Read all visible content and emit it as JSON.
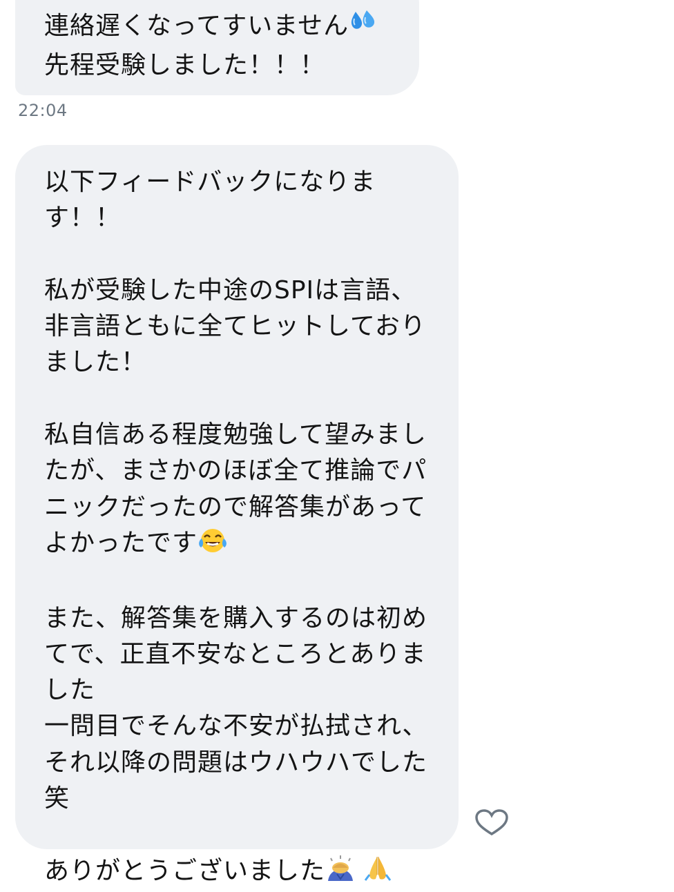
{
  "messages": [
    {
      "lines_before_emoji": "連絡遅くなってすいません",
      "emoji_1": "sweat-droplets-icon",
      "line_2": "先程受験しました！！！"
    },
    {
      "timestamp": "22:04"
    },
    {
      "p1": "以下フィードバックになりま\nす！！",
      "p2": "私が受験した中途のSPIは言語、\n非言語ともに全てヒットしており\nました！",
      "p3": "私自信ある程度勉強して望みまし\nたが、まさかのほぼ全て推論でパ\nニックだったので解答集があって\nよかったです",
      "p3_emoji": "tears-of-joy-icon",
      "p4": "また、解答集を購入するのは初め\nてで、正直不安なところとありま\nした\n一問目でそんな不安が払拭され、\nそれ以降の問題はウハウハでした\n笑",
      "p5": "ありがとうございました",
      "p5_emojis": [
        "bowing-person-icon",
        "folded-hands-icon"
      ]
    }
  ],
  "reaction": {
    "icon": "heart-icon",
    "color": "#6d7883"
  },
  "colors": {
    "bubble": "#eff1f4",
    "text": "#141414",
    "timestamp": "#6d7883"
  }
}
